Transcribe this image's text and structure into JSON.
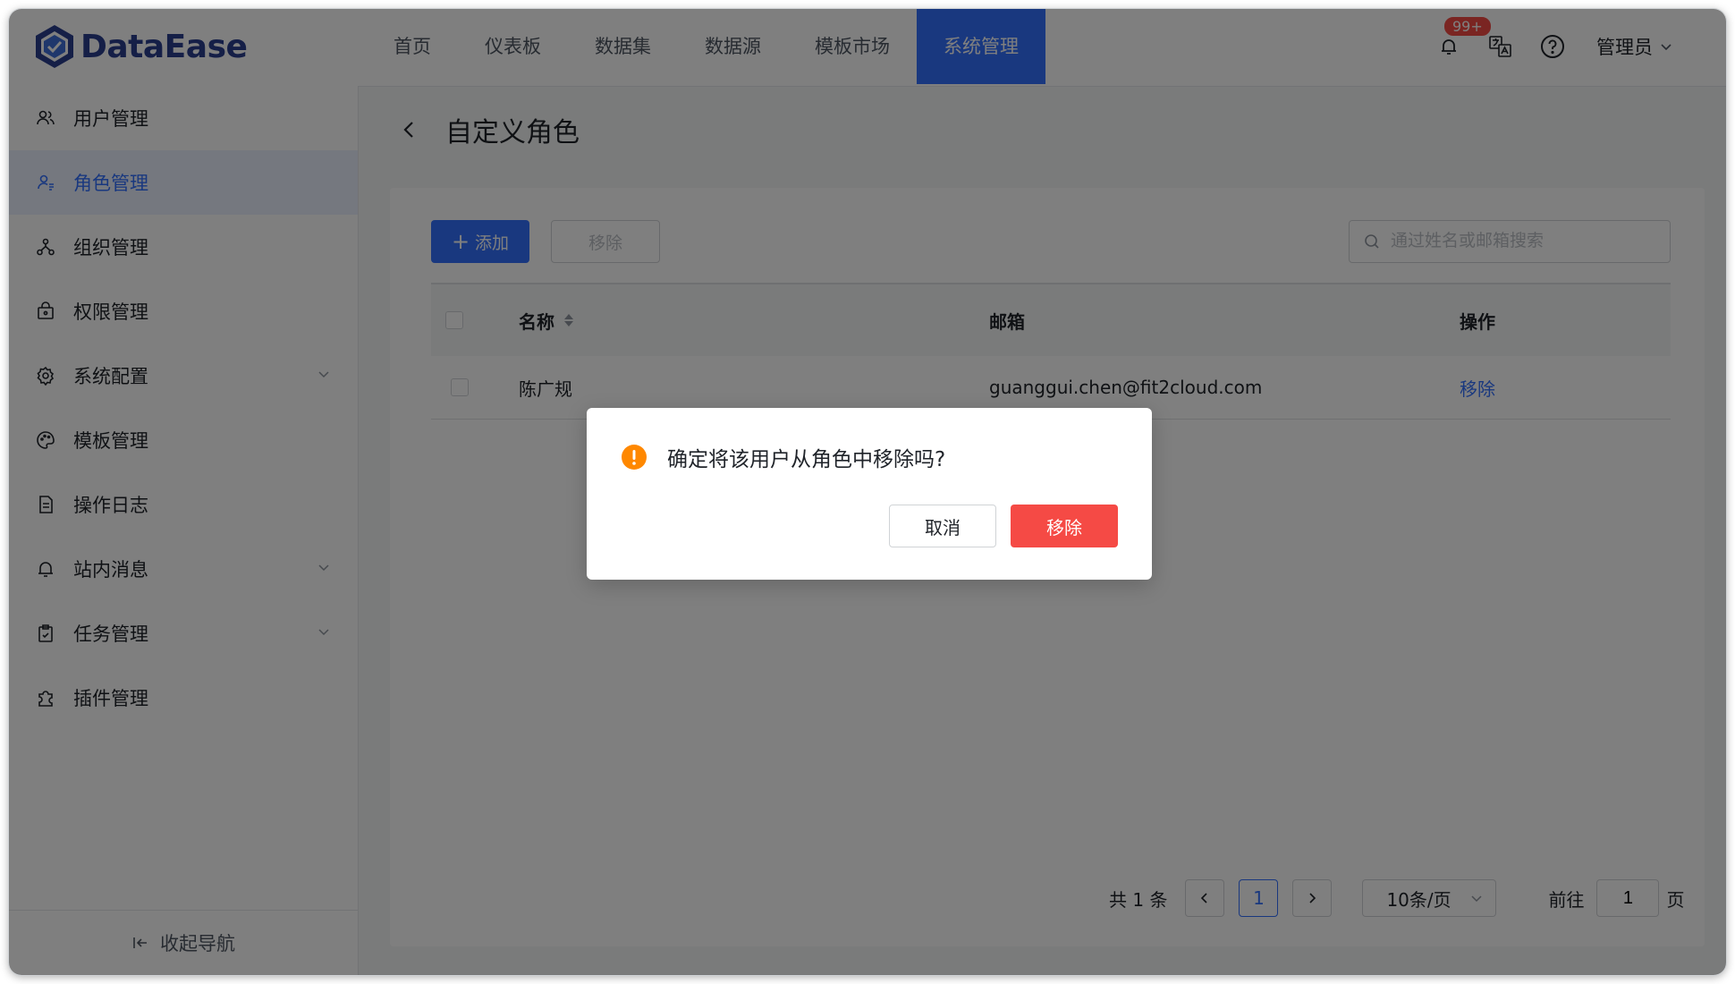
{
  "app": {
    "logo_text": "DataEase"
  },
  "nav": {
    "items": [
      {
        "label": "首页"
      },
      {
        "label": "仪表板"
      },
      {
        "label": "数据集"
      },
      {
        "label": "数据源"
      },
      {
        "label": "模板市场"
      },
      {
        "label": "系统管理"
      }
    ],
    "active_index": 5
  },
  "header": {
    "notification_badge": "99+",
    "user_label": "管理员",
    "icons": [
      "bell-icon",
      "translate-icon",
      "help-icon",
      "chevron-down-icon"
    ]
  },
  "sidebar": {
    "items": [
      {
        "label": "用户管理",
        "icon": "users-icon"
      },
      {
        "label": "角色管理",
        "icon": "role-icon",
        "active": true
      },
      {
        "label": "组织管理",
        "icon": "org-icon"
      },
      {
        "label": "权限管理",
        "icon": "lock-icon"
      },
      {
        "label": "系统配置",
        "icon": "gear-icon",
        "expandable": true
      },
      {
        "label": "模板管理",
        "icon": "palette-icon"
      },
      {
        "label": "操作日志",
        "icon": "document-icon"
      },
      {
        "label": "站内消息",
        "icon": "bell-icon",
        "expandable": true
      },
      {
        "label": "任务管理",
        "icon": "clipboard-icon",
        "expandable": true
      },
      {
        "label": "插件管理",
        "icon": "plugin-icon"
      }
    ],
    "collapse_label": "收起导航"
  },
  "page": {
    "title": "自定义角色"
  },
  "toolbar": {
    "add_label": "添加",
    "remove_label": "移除",
    "search_placeholder": "通过姓名或邮箱搜索"
  },
  "table": {
    "columns": [
      "名称",
      "邮箱",
      "操作"
    ],
    "rows": [
      {
        "name": "陈广规",
        "email": "guanggui.chen@fit2cloud.com",
        "action": "移除"
      }
    ]
  },
  "pagination": {
    "total_text": "共 1 条",
    "current_page": "1",
    "page_size": "10条/页",
    "goto_prefix": "前往",
    "goto_value": "1",
    "goto_suffix": "页"
  },
  "dialog": {
    "message": "确定将该用户从角色中移除吗?",
    "cancel_label": "取消",
    "confirm_label": "移除"
  },
  "colors": {
    "primary": "#3370ff",
    "danger": "#f54a45",
    "warning": "#ff8800",
    "logo": "#2a3e8e"
  }
}
